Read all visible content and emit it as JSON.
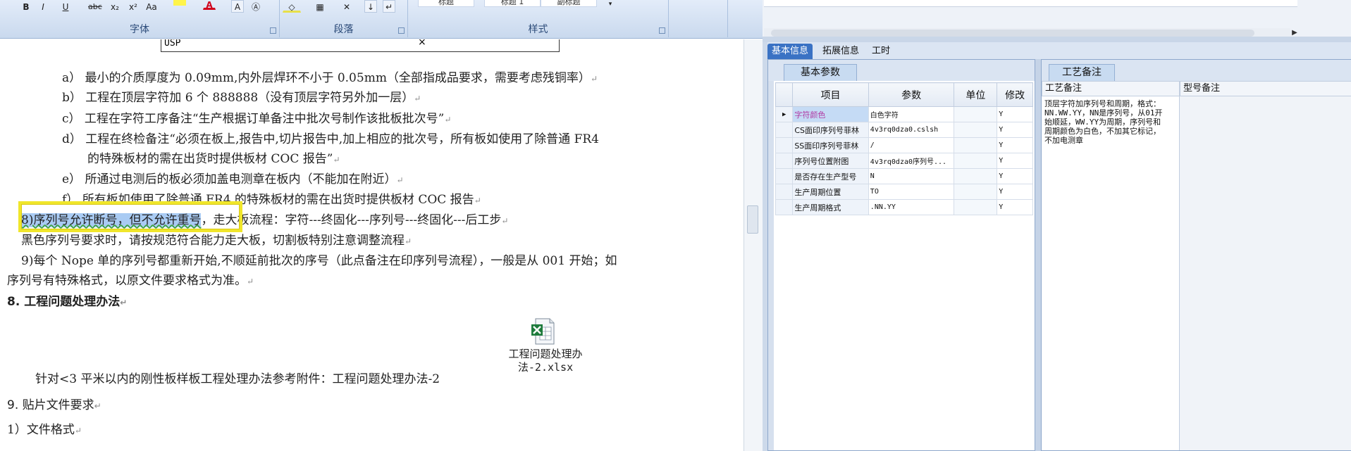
{
  "word": {
    "ribbon": {
      "groups": [
        {
          "label": "字体"
        },
        {
          "label": "段落"
        },
        {
          "label": "样式"
        }
      ],
      "font_buttons": [
        "B",
        "I",
        "U",
        "abc",
        "x₂",
        "x²",
        "Aa",
        "A",
        "Ⓐ"
      ],
      "style_chips": [
        "标题",
        "标题 1",
        "副标题"
      ]
    },
    "table_remnant": {
      "col1": "USP",
      "col2": "×"
    },
    "paragraphs": {
      "a": "a） 最小的介质厚度为 0.09mm,内外层焊环不小于 0.05mm（全部指成品要求，需要考虑残铜率）",
      "b": "b） 工程在顶层字符加 6 个 888888（没有顶层字符另外加一层）",
      "c": "c） 工程在字符工序备注“生产根据订单备注中批次号制作该批板批次号”",
      "d1": "d） 工程在终检备注“必须在板上,报告中,切片报告中,加上相应的批次号，所有板如使用了除普通 FR4",
      "d2": "的特殊板材的需在出货时提供板材 COC 报告”",
      "e": "e） 所通过电测后的板必须加盖电测章在板内（不能加在附近）",
      "f": "f） 所有板如使用了除普通 FR4 的特殊板材的需在出货时提供板材 COC 报告",
      "p8_selected": "8)序列号允许断号，但不允许重号",
      "p8_rest": "，走大板流程：字符---终固化---序列号---终固化---后工步",
      "p8_line2": "黑色序列号要求时，请按规范符合能力走大板，切割板特别注意调整流程",
      "p9_line1": "9)每个 Nope 单的序列号都重新开始,不顺延前批次的序号（此点备注在印序列号流程），一般是从 001 开始；如",
      "p9_line2": "序列号有特殊格式，以原文件要求格式为准。",
      "h8": "8.  工程问题处理办法",
      "attach_line": "针对<3 平米以内的刚性板样板工程处理办法参考附件：工程问题处理办法-2",
      "attachment_name": "工程问题处理办法-2.xlsx",
      "h9": "9. 贴片文件要求",
      "item1": "1）文件格式"
    },
    "paragraph_mark": "↵",
    "colors": {
      "highlight": "#a9cbf3",
      "callout": "#f0e62b"
    }
  },
  "app": {
    "tabs": [
      {
        "label": "基本信息",
        "active": true
      },
      {
        "label": "拓展信息",
        "active": false
      },
      {
        "label": "工时",
        "active": false
      }
    ],
    "left_panel": {
      "tab": "基本参数",
      "columns": [
        "项目",
        "参数",
        "单位",
        "修改"
      ],
      "rows": [
        {
          "indicator": "▶",
          "name": "字符颜色",
          "param": "白色字符",
          "unit": "",
          "modify": "Y"
        },
        {
          "indicator": "",
          "name": "CS面印序列号菲林",
          "param": "4v3rq0dza0.cslsh",
          "unit": "",
          "modify": "Y"
        },
        {
          "indicator": "",
          "name": "SS面印序列号菲林",
          "param": "/",
          "unit": "",
          "modify": "Y"
        },
        {
          "indicator": "",
          "name": "序列号位置附图",
          "param": "4v3rq0dza0序列号...",
          "unit": "",
          "modify": "Y"
        },
        {
          "indicator": "",
          "name": "是否存在生产型号",
          "param": "N",
          "unit": "",
          "modify": "Y"
        },
        {
          "indicator": "",
          "name": "生产周期位置",
          "param": "TO",
          "unit": "",
          "modify": "Y"
        },
        {
          "indicator": "",
          "name": "生产周期格式",
          "param": ".NN.YY",
          "unit": "",
          "modify": "Y"
        }
      ]
    },
    "right_panel": {
      "tab": "工艺备注",
      "col1_header": "工艺备注",
      "col2_header": "型号备注",
      "note": "顶层字符加序列号和周期，格式：NN.WW.YY，NN是序列号，从01开始顺延，WW.YY为周期，序列号和周期颜色为白色，不加其它标记，不加电测章"
    },
    "colors": {
      "active_tab": "#3a72c4",
      "selected_cell": "#c5dbf5",
      "selected_text": "#b13aa3"
    }
  }
}
